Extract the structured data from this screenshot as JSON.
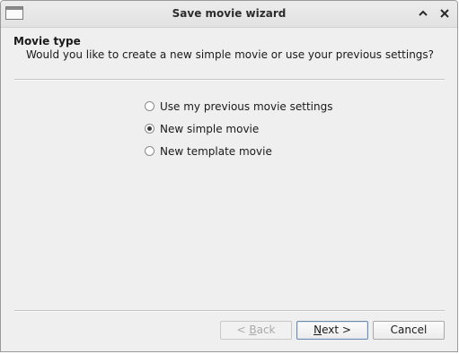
{
  "window": {
    "title": "Save movie wizard",
    "app_icon": "window-icon",
    "controls": [
      {
        "name": "shade",
        "icon": "chevron-up-icon"
      },
      {
        "name": "close",
        "icon": "close-icon"
      }
    ]
  },
  "page": {
    "title": "Movie type",
    "description": "Would you like to create a new simple movie or use your previous settings?"
  },
  "options": [
    {
      "label": "Use my previous movie settings",
      "selected": false
    },
    {
      "label": "New simple movie",
      "selected": true
    },
    {
      "label": "New template movie",
      "selected": false
    }
  ],
  "buttons": {
    "back": {
      "prefix": "< ",
      "mnemonic": "B",
      "rest": "ack",
      "enabled": false
    },
    "next": {
      "prefix": "",
      "mnemonic": "N",
      "rest": "ext >",
      "enabled": true,
      "default": true
    },
    "cancel": {
      "label": "Cancel",
      "enabled": true
    }
  },
  "colors": {
    "window_bg": "#efefef",
    "titlebar_bg": "#e6e6e6",
    "disabled_text": "#a9a9a9",
    "default_button_border": "#6f8bb0"
  }
}
